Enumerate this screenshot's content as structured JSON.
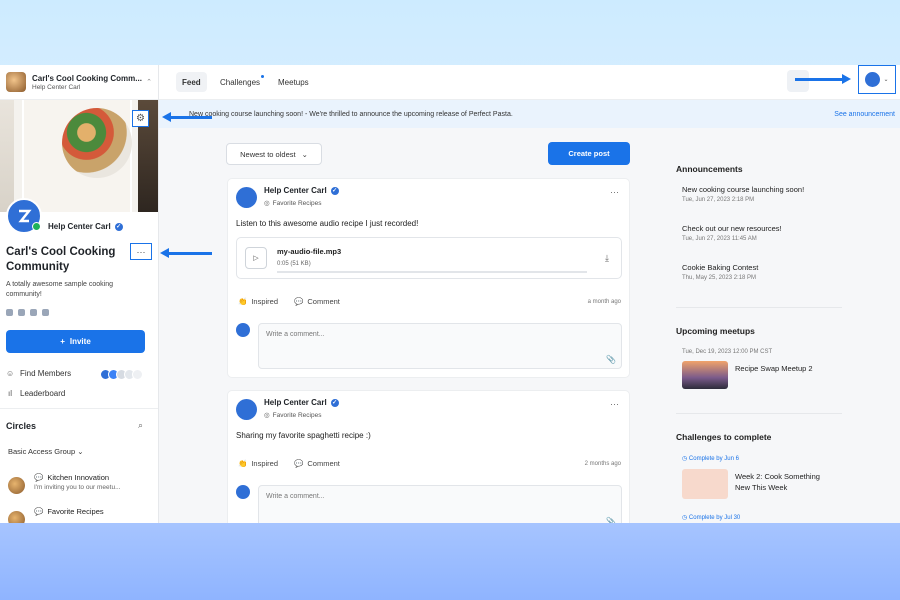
{
  "sidebar": {
    "community_short": "Carl's Cool Cooking Comm...",
    "account": "Help Center Carl",
    "host_name": "Help Center Carl",
    "community_title": "Carl's Cool Cooking Community",
    "description": "A totally awesome sample cooking community!",
    "invite_label": "Invite",
    "find_members": "Find Members",
    "leaderboard": "Leaderboard",
    "circles_title": "Circles",
    "group_select": "Basic Access Group",
    "circles": [
      {
        "title": "Kitchen Innovation",
        "subtitle": "I'm inviting you to our meetu..."
      },
      {
        "title": "Favorite Recipes",
        "subtitle": ""
      }
    ]
  },
  "topbar": {
    "tabs": [
      "Feed",
      "Challenges",
      "Meetups"
    ]
  },
  "announcement_bar": {
    "message": "New cooking course launching soon! - We're thrilled to announce the upcoming release of Perfect Pasta.",
    "link": "See announcement"
  },
  "feed": {
    "sort_label": "Newest to oldest",
    "create_label": "Create post",
    "posts": [
      {
        "author": "Help Center Carl",
        "circle": "Favorite Recipes",
        "body": "Listen to this awesome audio recipe I just recorded!",
        "file_name": "my-audio-file.mp3",
        "file_meta": "0:05 (51 KB)",
        "inspired": "Inspired",
        "comment": "Comment",
        "time": "a month ago",
        "comment_placeholder": "Write a comment..."
      },
      {
        "author": "Help Center Carl",
        "circle": "Favorite Recipes",
        "body": "Sharing my favorite spaghetti recipe :)",
        "inspired": "Inspired",
        "comment": "Comment",
        "time": "2 months ago",
        "comment_placeholder": "Write a comment..."
      }
    ]
  },
  "right": {
    "announcements_title": "Announcements",
    "announcements": [
      {
        "title": "New cooking course launching soon!",
        "date": "Tue, Jun 27, 2023 2:18 PM"
      },
      {
        "title": "Check out our new resources!",
        "date": "Tue, Jun 27, 2023 11:45 AM"
      },
      {
        "title": "Cookie Baking Contest",
        "date": "Thu, May 25, 2023 2:18 PM"
      }
    ],
    "meetups_title": "Upcoming meetups",
    "meetup": {
      "date": "Tue, Dec 19, 2023 12:00 PM CST",
      "title": "Recipe Swap Meetup 2"
    },
    "challenges_title": "Challenges to complete",
    "challenges": [
      {
        "due": "Complete by Jun 6",
        "title": "Week 2: Cook Something New This Week"
      },
      {
        "due": "Complete by Jul 30",
        "title": ""
      }
    ]
  },
  "colors": {
    "accent": "#1a73e8",
    "online": "#20b25a"
  }
}
